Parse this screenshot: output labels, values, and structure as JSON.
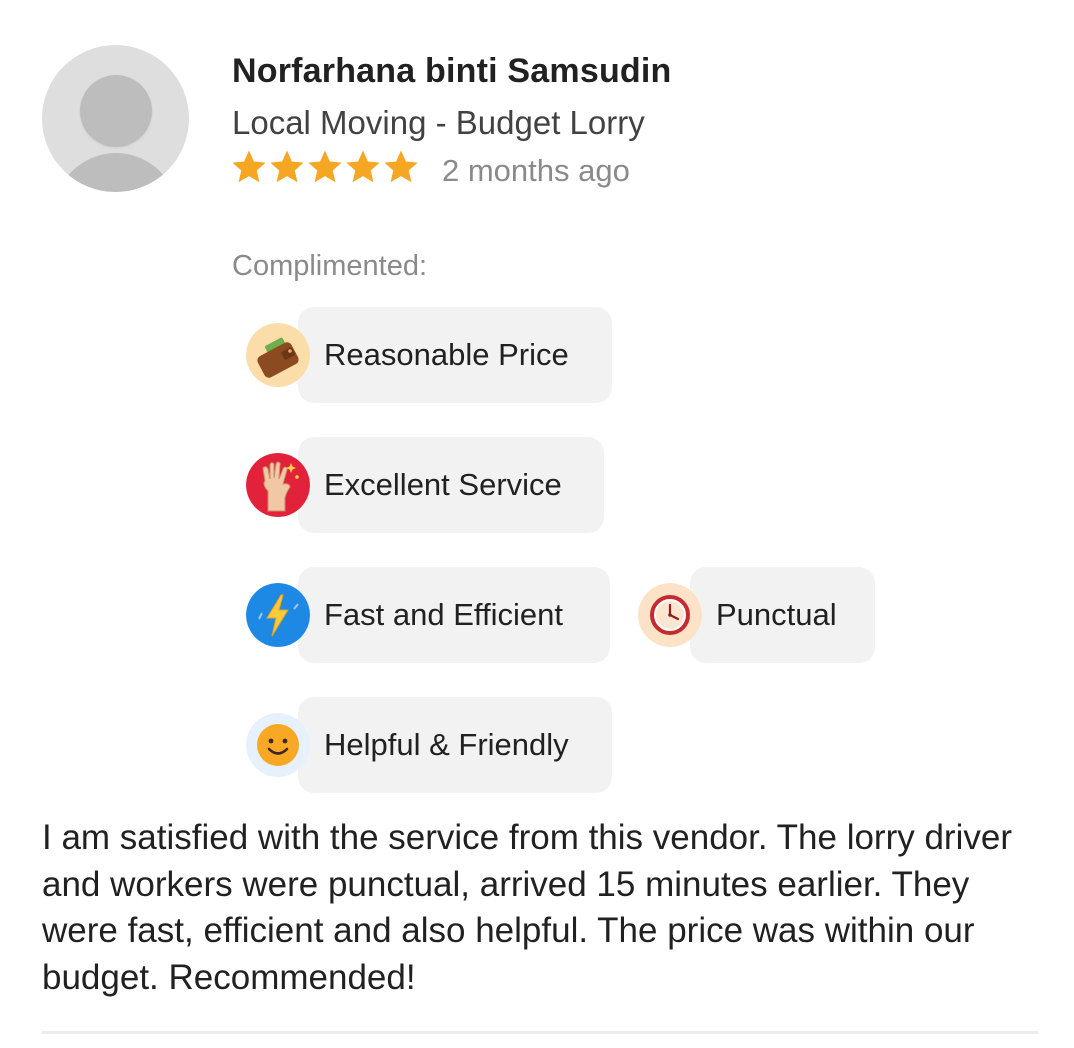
{
  "review": {
    "reviewer_name": "Norfarhana binti Samsudin",
    "service": "Local Moving - Budget Lorry",
    "rating": 5,
    "rating_max": 5,
    "time_ago": "2 months ago",
    "star_color": "#F5A623",
    "complimented_label": "Complimented:",
    "compliments": [
      {
        "label": "Reasonable Price",
        "icon": "wallet-icon"
      },
      {
        "label": "Excellent Service",
        "icon": "ok-hand-icon"
      },
      {
        "label": "Fast and Efficient",
        "icon": "lightning-icon"
      },
      {
        "label": "Punctual",
        "icon": "clock-icon"
      },
      {
        "label": "Helpful & Friendly",
        "icon": "smiley-icon"
      }
    ],
    "text": "I am satisfied with the service from this vendor. The lorry driver and workers were punctual, arrived 15 minutes earlier. They were fast, efficient and also helpful. The price was within our budget. Recommended!"
  }
}
